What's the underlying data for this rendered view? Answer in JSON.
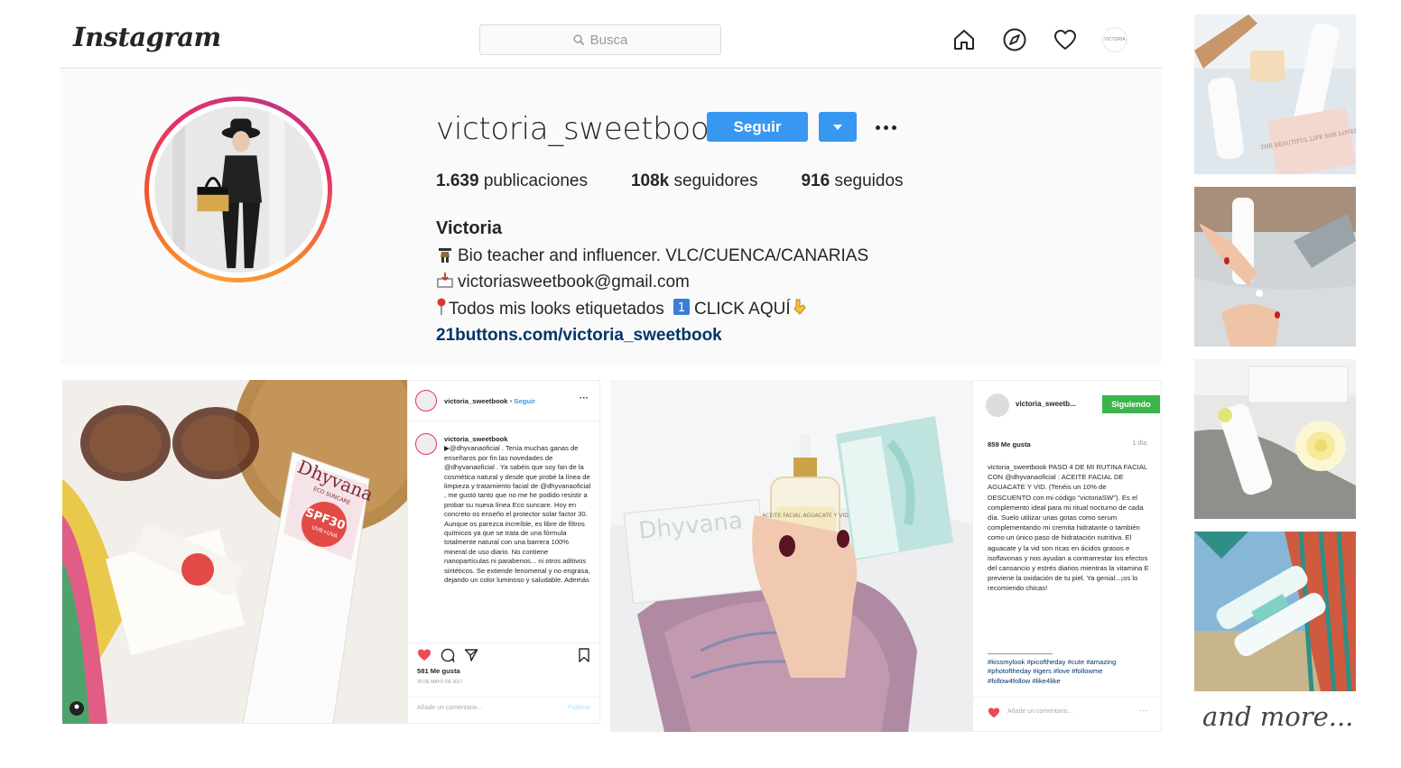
{
  "header": {
    "logo": "Instagram",
    "search_placeholder": "Busca",
    "icons": [
      "home-icon",
      "explore-icon",
      "activity-heart-icon",
      "profile-avatar"
    ],
    "avatar_text": "VICTORIA"
  },
  "profile": {
    "username": "victoria_sweetbook",
    "follow_label": "Seguir",
    "stats": [
      {
        "num": "1.639",
        "label": "publicaciones"
      },
      {
        "num": "108k",
        "label": "seguidores"
      },
      {
        "num": "916",
        "label": "seguidos"
      }
    ],
    "name": "Victoria",
    "bio_lines": [
      "Bio teacher and influencer. VLC/CUENCA/CANARIAS",
      "victoriasweetbook@gmail.com",
      "Todos mis looks etiquetados",
      "CLICK AQUÍ"
    ],
    "link": "21buttons.com/victoria_sweetbook"
  },
  "post1": {
    "user": "victoria_sweetbook",
    "dot_follow": "• Seguir",
    "caption_user": "victoria_sweetbook",
    "caption": "▶@dhyvanaoficial . Tenía muchas ganas de enseñaros por fin las novedades de @dhyvanaoficial . Ya sabéis que soy fan de la cosmética natural y desde que probé la línea de limpieza y tratamiento facial de @dhyvanaoficial , me gustó tanto que no me he podido resistir a probar su nueva línea Eco suncare. Hoy en concreto os enseño el protector solar factor 30. Aunque os parezca increíble, es libre de filtros químicos ya que se trata de una fórmula totalmente natural con una barrera 100% mineral de uso diario. No contiene nanopartículas ni parabenos... ni otros aditivos sintéticos. Se extiende fenomenal y no engrasa, dejando un color luminoso y saludable. Además",
    "likes": "581 Me gusta",
    "date": "30 DE MAYO DE 2017",
    "comment_placeholder": "Añade un comentario...",
    "publish": "Publicar"
  },
  "post2": {
    "user": "victoria_sweetb...",
    "following_label": "Siguiendo",
    "likes": "859 Me gusta",
    "time": "1 día",
    "caption": "victoria_sweetbook PASO 4 DE MI RUTINA FACIAL CON @dhyvanaoficial : ACEITE FACIAL DE AGUACATE Y VID. (Tenéis un 10% de DESCUENTO con mi código \"victoriaSW\"). Es el complemento ideal para mi ritual nocturno de cada día. Suelo utilizar unas gotas como serum complementando mi cremita hidratante o también como un único paso de hidratación nutritiva. El aguacate y la vid son ricas en ácidos grasos e isoflavonas y nos ayudan a contrarrestar los efectos del cansancio y estrés diarios mientras la vitamina E previene la oxidación de tu piel. Ya genial...¡os lo recomiendo chicas!",
    "hashtags": "#kissmylook #picoftheday #cute #amazing #photoftheday #igers #love #followme #follow4follow #like4like",
    "comment_placeholder": "Añade un comentario..."
  },
  "photo_text": {
    "brand": "Dhyvana",
    "brand_sub": "ECO SUNCARE",
    "spf": "SPF30",
    "spf_sub": "UVB+UVA",
    "bottle_label": "ACEITE FACIAL AGUACATE Y VID",
    "box_text": "Dhyvana",
    "card_text": "THE BEAUTIFUL LIFE SHE LOVED"
  },
  "sidebar": {
    "more_label": "and more..."
  }
}
